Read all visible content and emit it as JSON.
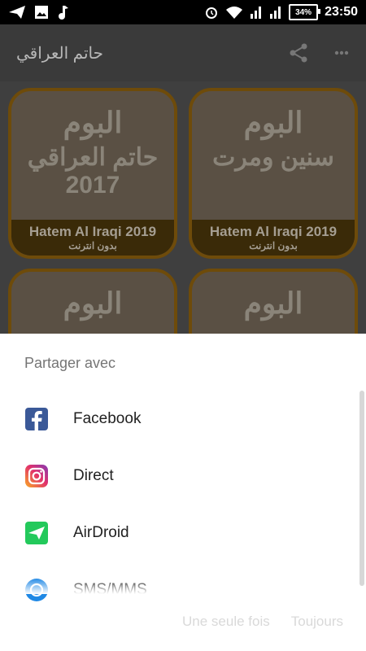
{
  "status_bar": {
    "battery": "34%",
    "time": "23:50"
  },
  "app_bar": {
    "title": "حاتم العراقي"
  },
  "background_tiles": [
    {
      "line1": "البوم",
      "line2": "حاتم العراقي",
      "line3": "2017",
      "brand": "Hatem Al Iraqi  2019",
      "sub": "بدون انترنت"
    },
    {
      "line1": "البوم",
      "line2": "سنين ومرت",
      "line3": "",
      "brand": "Hatem Al Iraqi  2019",
      "sub": "بدون انترنت"
    },
    {
      "line1": "البوم"
    },
    {
      "line1": "البوم"
    }
  ],
  "share_sheet": {
    "title": "Partager avec",
    "apps": [
      {
        "label": "Facebook",
        "icon": "facebook-icon"
      },
      {
        "label": "Direct",
        "icon": "instagram-icon"
      },
      {
        "label": "AirDroid",
        "icon": "airdroid-icon"
      },
      {
        "label": "SMS/MMS",
        "icon": "messages-icon"
      }
    ],
    "buttons": {
      "once": "Une seule fois",
      "always": "Toujours"
    }
  },
  "colors": {
    "facebook": "#3b5998",
    "instagram": "#c13584",
    "airdroid": "#23c95b",
    "messages": "#1e88e5"
  }
}
